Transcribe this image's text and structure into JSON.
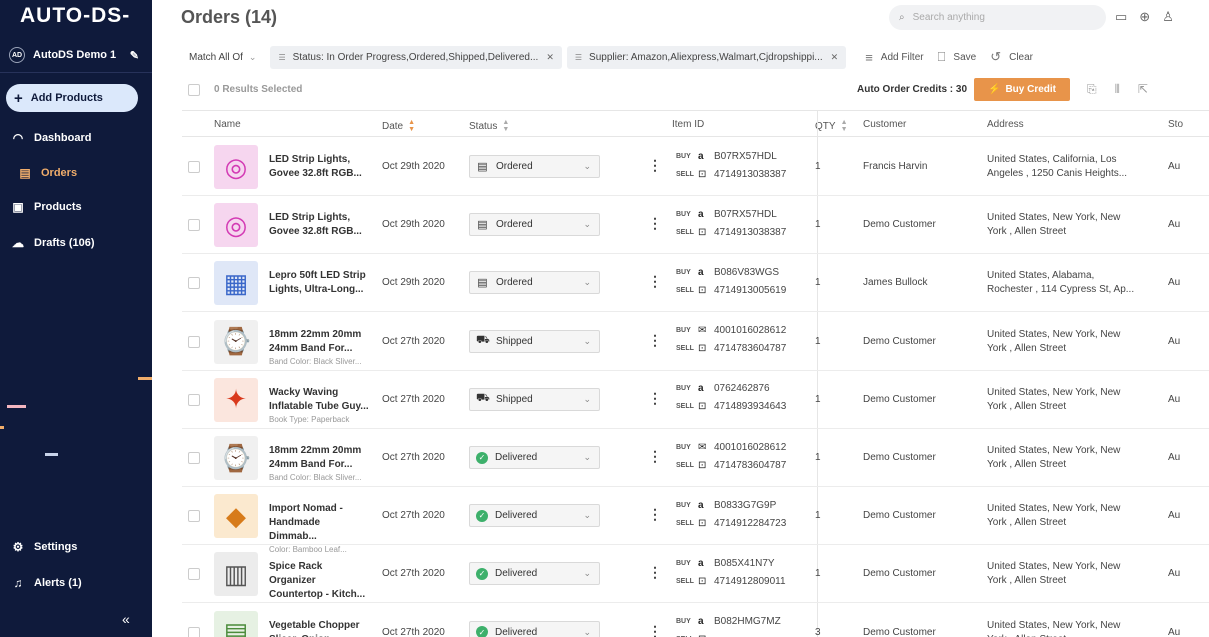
{
  "sidebar": {
    "logo": "AUTO-DS-",
    "account": {
      "initials": "AD",
      "name": "AutoDS Demo 1"
    },
    "add_products": "Add Products",
    "nav": [
      {
        "label": "Dashboard",
        "icon": "gauge-icon"
      },
      {
        "label": "Orders",
        "icon": "receipt-icon"
      },
      {
        "label": "Products",
        "icon": "box-icon"
      },
      {
        "label": "Drafts (106)",
        "icon": "cloud-upload-icon"
      }
    ],
    "settings": "Settings",
    "alerts": "Alerts (1)",
    "collapse": "«"
  },
  "header": {
    "title": "Orders (14)",
    "search_placeholder": "Search anything"
  },
  "filters": {
    "match": "Match All Of",
    "chips": [
      "Status: In Order Progress,Ordered,Shipped,Delivered...",
      "Supplier: Amazon,Aliexpress,Walmart,Cjdropshippi..."
    ],
    "add_filter": "Add Filter",
    "save": "Save",
    "clear": "Clear"
  },
  "toolbar": {
    "selected": "0 Results Selected",
    "credits": "Auto Order Credits : 30",
    "buy_credit": "Buy Credit"
  },
  "columns": [
    "Name",
    "Date",
    "Status",
    "Item ID",
    "QTY",
    "Customer",
    "Address",
    "Sto"
  ],
  "orders": [
    {
      "name": "LED Strip Lights, Govee 32.8ft RGB...",
      "variant": "",
      "date": "Oct 29th 2020",
      "status": "Ordered",
      "buy_id": "B07RX57HDL",
      "buy_source": "amazon",
      "sell_id": "4714913038387",
      "qty": "1",
      "customer": "Francis Harvin",
      "address": "United States, California, Los Angeles , 1250 Canis Heights...",
      "store": "Au"
    },
    {
      "name": "LED Strip Lights, Govee 32.8ft RGB...",
      "variant": "",
      "date": "Oct 29th 2020",
      "status": "Ordered",
      "buy_id": "B07RX57HDL",
      "buy_source": "amazon",
      "sell_id": "4714913038387",
      "qty": "1",
      "customer": "Demo Customer",
      "address": "United States, New York, New York , Allen Street",
      "store": "Au"
    },
    {
      "name": "Lepro 50ft LED Strip Lights, Ultra-Long...",
      "variant": "",
      "date": "Oct 29th 2020",
      "status": "Ordered",
      "buy_id": "B086V83WGS",
      "buy_source": "amazon",
      "sell_id": "4714913005619",
      "qty": "1",
      "customer": "James Bullock",
      "address": "United States, Alabama, Rochester , 114 Cypress St, Ap...",
      "store": "Au"
    },
    {
      "name": "18mm 22mm 20mm 24mm Band For...",
      "variant": "Band Color: Black Sliver...",
      "date": "Oct 27th 2020",
      "status": "Shipped",
      "buy_id": "4001016028612",
      "buy_source": "aliexpress",
      "sell_id": "4714783604787",
      "qty": "1",
      "customer": "Demo Customer",
      "address": "United States, New York, New York , Allen Street",
      "store": "Au"
    },
    {
      "name": "Wacky Waving Inflatable Tube Guy...",
      "variant": "Book Type: Paperback",
      "date": "Oct 27th 2020",
      "status": "Shipped",
      "buy_id": "0762462876",
      "buy_source": "amazon",
      "sell_id": "4714893934643",
      "qty": "1",
      "customer": "Demo Customer",
      "address": "United States, New York, New York , Allen Street",
      "store": "Au"
    },
    {
      "name": "18mm 22mm 20mm 24mm Band For...",
      "variant": "Band Color: Black Sliver...",
      "date": "Oct 27th 2020",
      "status": "Delivered",
      "buy_id": "4001016028612",
      "buy_source": "aliexpress",
      "sell_id": "4714783604787",
      "qty": "1",
      "customer": "Demo Customer",
      "address": "United States, New York, New York , Allen Street",
      "store": "Au"
    },
    {
      "name": "Import Nomad - Handmade Dimmab...",
      "variant": "Color: Bamboo Leaf...",
      "date": "Oct 27th 2020",
      "status": "Delivered",
      "buy_id": "B0833G7G9P",
      "buy_source": "amazon",
      "sell_id": "4714912284723",
      "qty": "1",
      "customer": "Demo Customer",
      "address": "United States, New York, New York , Allen Street",
      "store": "Au"
    },
    {
      "name": "Spice Rack Organizer Countertop - Kitch...",
      "variant": "",
      "date": "Oct 27th 2020",
      "status": "Delivered",
      "buy_id": "B085X41N7Y",
      "buy_source": "amazon",
      "sell_id": "4714912809011",
      "qty": "1",
      "customer": "Demo Customer",
      "address": "United States, New York, New York , Allen Street",
      "store": "Au"
    },
    {
      "name": "Vegetable Chopper Slicer, Onion...",
      "variant": "",
      "date": "Oct 27th 2020",
      "status": "Delivered",
      "buy_id": "B082HMG7MZ",
      "buy_source": "amazon",
      "sell_id": "",
      "qty": "3",
      "customer": "Demo Customer",
      "address": "United States, New York, New York , Allen Street",
      "store": "Au"
    }
  ],
  "labels": {
    "buy": "BUY",
    "sell": "SELL"
  },
  "colors": {
    "sidebar_bg": "#0f1a3b",
    "accent": "#e8944a",
    "delivered": "#3db06b"
  }
}
